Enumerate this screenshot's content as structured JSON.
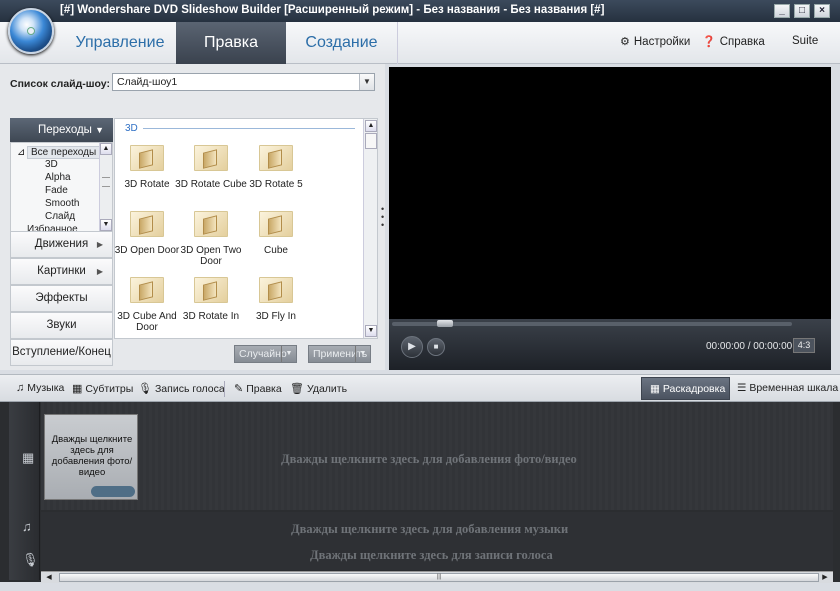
{
  "window": {
    "title": "[#] Wondershare DVD Slideshow Builder [Расширенный режим] - Без названия - Без названия [#]",
    "min": "_",
    "max": "□",
    "close": "×"
  },
  "menu": {
    "tabs": [
      "Управление",
      "Правка",
      "Создание"
    ],
    "active_tab": "Правка",
    "settings": "Настройки",
    "help": "Справка",
    "suite": "Suite"
  },
  "slideshow": {
    "label": "Список слайд-шоу:",
    "value": "Слайд-шоу1"
  },
  "categories": {
    "transitions": "Переходы",
    "tree": {
      "all": "Все переходы",
      "items": [
        "3D",
        "Alpha",
        "Fade",
        "Smooth",
        "Слайд",
        "Избранное"
      ]
    },
    "buttons": [
      "Движения",
      "Картинки",
      "Эффекты",
      "Звуки",
      "Вступление/Конец"
    ]
  },
  "grid": {
    "section": "3D",
    "items": [
      "3D Rotate",
      "3D Rotate Cube",
      "3D Rotate 5",
      "3D Open Door",
      "3D Open Two Door",
      "Cube",
      "3D Cube And Door",
      "3D Rotate In",
      "3D Fly In"
    ]
  },
  "grid_buttons": {
    "random": "Случайно",
    "apply": "Применить"
  },
  "player": {
    "time": "00:00:00 / 00:00:00",
    "ratio": "4:3"
  },
  "storyboard_toolbar": {
    "music": "Музыка",
    "subtitles": "Субтитры",
    "voice": "Запись голоса",
    "edit": "Правка",
    "delete": "Удалить",
    "storyboard": "Раскадровка",
    "timeline": "Временная шкала"
  },
  "storyboard": {
    "slot_text": "Дважды щелкните здесь для добавления фото/видео",
    "hint_photo": "Дважды щелкните здесь для добавления фото/видео",
    "hint_music": "Дважды щелкните здесь для добавления музыки",
    "hint_voice": "Дважды щелкните здесь для записи голоса"
  }
}
